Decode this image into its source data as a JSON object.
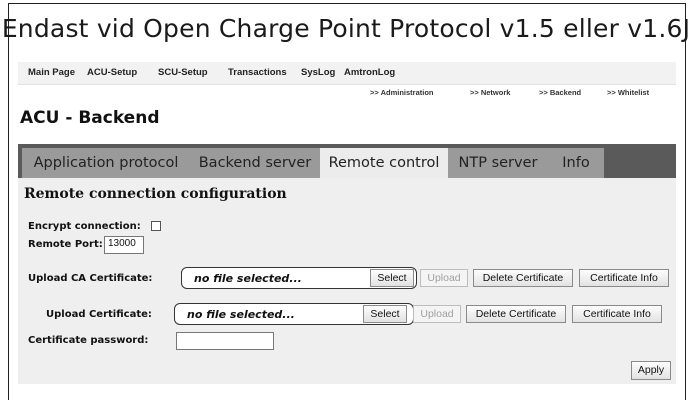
{
  "caption": "Endast vid Open Charge Point Protocol v1.5 eller v1.6J",
  "nav": [
    "Main Page",
    "ACU-Setup",
    "SCU-Setup",
    "Transactions",
    "SysLog",
    "AmtronLog"
  ],
  "breadcrumbs": [
    ">> Administration",
    ">> Network",
    ">> Backend",
    ">> Whitelist"
  ],
  "page_title": "ACU - Backend",
  "tabs": [
    "Application protocol",
    "Backend server",
    "Remote control",
    "NTP server",
    "Info"
  ],
  "active_tab": "Remote control",
  "section_title": "Remote connection configuration",
  "encrypt_label": "Encrypt connection:",
  "encrypt_checked": false,
  "port_label": "Remote Port:",
  "port_value": "13000",
  "ca_label": "Upload CA Certificate:",
  "ca_file": "no file selected...",
  "cert_label": "Upload Certificate:",
  "cert_file": "no file selected...",
  "password_label": "Certificate password:",
  "password_value": "",
  "buttons": {
    "select": "Select",
    "upload": "Upload",
    "delete": "Delete Certificate",
    "info": "Certificate Info",
    "apply": "Apply"
  }
}
